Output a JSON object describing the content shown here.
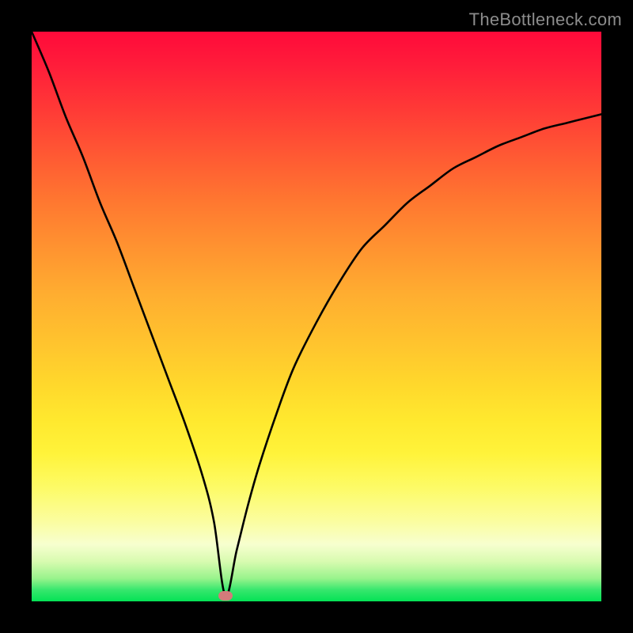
{
  "watermark": "TheBottleneck.com",
  "colors": {
    "frame": "#000000",
    "watermark": "#8c8c8c",
    "curve": "#000000",
    "marker": "#d47b7b",
    "gradient_top": "#ff0a3a",
    "gradient_bottom": "#04e255"
  },
  "chart_data": {
    "type": "line",
    "title": "",
    "xlabel": "",
    "ylabel": "",
    "xlim": [
      0,
      100
    ],
    "ylim": [
      0,
      100
    ],
    "grid": false,
    "legend": false,
    "annotations": [],
    "marker": {
      "x": 34,
      "y": 1
    },
    "series": [
      {
        "name": "bottleneck-curve",
        "x": [
          0,
          3,
          6,
          9,
          12,
          15,
          18,
          21,
          24,
          27,
          30,
          32,
          34,
          36,
          38,
          40,
          43,
          46,
          50,
          54,
          58,
          62,
          66,
          70,
          74,
          78,
          82,
          86,
          90,
          94,
          98,
          100
        ],
        "y": [
          100,
          93,
          85,
          78,
          70,
          63,
          55,
          47,
          39,
          31,
          22,
          14,
          1,
          9,
          17,
          24,
          33,
          41,
          49,
          56,
          62,
          66,
          70,
          73,
          76,
          78,
          80,
          81.5,
          83,
          84,
          85,
          85.5
        ]
      }
    ]
  }
}
